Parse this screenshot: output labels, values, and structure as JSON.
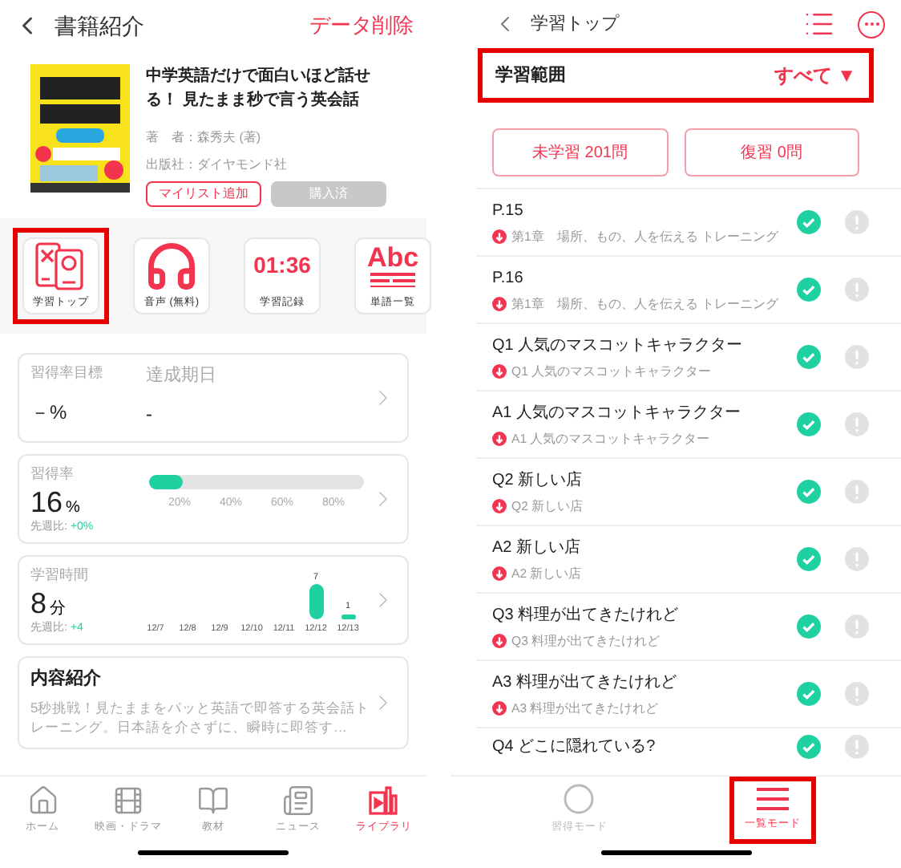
{
  "left": {
    "header": {
      "title": "書籍紹介",
      "action": "データ削除"
    },
    "book": {
      "title": "中学英語だけで面白いほど話せる！ 見たまま秒で言う英会話",
      "author": "著　者：森秀夫 (著)",
      "publisher": "出版社：ダイヤモンド社",
      "add_button": "マイリスト追加",
      "buy_button": {
        "label": "購入済",
        "disabled": true
      }
    },
    "tiles": [
      {
        "kind": "devices",
        "label": "学習トップ",
        "highlighted": true
      },
      {
        "kind": "headphones",
        "label": "音声 (無料)",
        "highlighted": false
      },
      {
        "kind": "clock",
        "display": "01:36",
        "label": "学習記録",
        "highlighted": false
      },
      {
        "kind": "words",
        "display": "Abc",
        "label": "単語一覧",
        "highlighted": false
      }
    ],
    "goal_card": {
      "label": "習得率目標",
      "value": "－%",
      "date_label": "達成期日",
      "date_value": "-"
    },
    "rate_card": {
      "label": "習得率",
      "value": "16",
      "unit": "%",
      "compare_label": "先週比:",
      "compare_value": "+0%",
      "level": 0.16,
      "ticks": [
        "20%",
        "40%",
        "60%",
        "80%"
      ]
    },
    "time_card": {
      "label": "学習時間",
      "value": "8",
      "unit": "分",
      "compare_label": "先週比:",
      "compare_value": "+4",
      "chart_data": {
        "type": "bar",
        "categories": [
          "12/7",
          "12/8",
          "12/9",
          "12/10",
          "12/11",
          "12/12",
          "12/13"
        ],
        "values": [
          null,
          null,
          null,
          null,
          null,
          7,
          1
        ],
        "data_labels": true
      }
    },
    "content_card": {
      "title": "内容紹介",
      "text": "5秒挑戦！見たままをパッと英語で即答する英会話トレーニング。日本語を介さずに、瞬時に即答す…"
    },
    "nav": [
      {
        "kind": "home",
        "label": "ホーム",
        "selected": false
      },
      {
        "kind": "film",
        "label": "映画・ドラマ",
        "selected": false
      },
      {
        "kind": "book",
        "label": "教材",
        "selected": false
      },
      {
        "kind": "news",
        "label": "ニュース",
        "selected": false
      },
      {
        "kind": "library",
        "label": "ライブラリ",
        "selected": true
      }
    ]
  },
  "right": {
    "header": {
      "title": "学習トップ"
    },
    "range": {
      "label": "学習範囲",
      "value": "すべて ▼",
      "highlighted": true
    },
    "buttons": [
      "未学習 201問",
      "復習 0問"
    ],
    "rows": [
      {
        "title": "P.15",
        "subtitle": "第1章　場所、もの、人を伝える トレーニング",
        "checked": true
      },
      {
        "title": "P.16",
        "subtitle": "第1章　場所、もの、人を伝える トレーニング",
        "checked": true
      },
      {
        "title": "Q1 人気のマスコットキャラクター",
        "subtitle": "Q1 人気のマスコットキャラクター",
        "checked": true
      },
      {
        "title": "A1 人気のマスコットキャラクター",
        "subtitle": "A1 人気のマスコットキャラクター",
        "checked": true
      },
      {
        "title": "Q2 新しい店",
        "subtitle": "Q2 新しい店",
        "checked": true
      },
      {
        "title": "A2 新しい店",
        "subtitle": "A2 新しい店",
        "checked": true
      },
      {
        "title": "Q3 料理が出てきたけれど",
        "subtitle": "Q3 料理が出てきたけれど",
        "checked": true
      },
      {
        "title": "A3 料理が出てきたけれど",
        "subtitle": "A3 料理が出てきたけれど",
        "checked": true
      },
      {
        "title": "Q4 どこに隠れている?",
        "checked": true
      }
    ],
    "modes": [
      {
        "kind": "circle",
        "label": "習得モード",
        "selected": false,
        "highlighted": false
      },
      {
        "kind": "lines",
        "label": "一覧モード",
        "selected": true,
        "highlighted": true
      }
    ]
  }
}
